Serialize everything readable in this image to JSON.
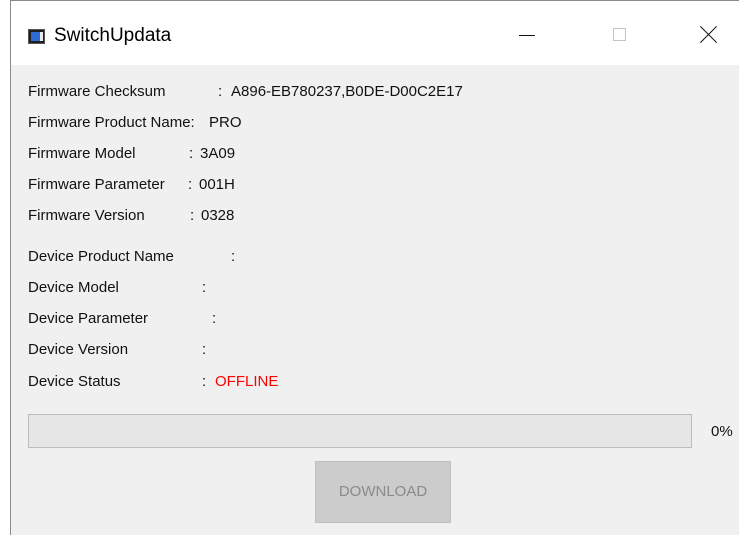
{
  "window": {
    "title": "SwitchUpdata",
    "icon": "app-window-icon",
    "controls": [
      "minimize-icon",
      "maximize-icon",
      "close-icon"
    ]
  },
  "firmware": [
    {
      "label": "Firmware Checksum",
      "sep": ":",
      "value": "A896-EB780237,B0DE-D00C2E17"
    },
    {
      "label": "Firmware Product Name:",
      "sep": "",
      "value": "PRO"
    },
    {
      "label": "Firmware Model",
      "sep": ":",
      "value": "3A09"
    },
    {
      "label": "Firmware Parameter",
      "sep": ":",
      "value": "001H"
    },
    {
      "label": "Firmware Version",
      "sep": ":",
      "value": "0328"
    }
  ],
  "device": [
    {
      "label": "Device Product Name",
      "sep": ":",
      "value": ""
    },
    {
      "label": "Device Model",
      "sep": ":",
      "value": ""
    },
    {
      "label": "Device Parameter",
      "sep": ":",
      "value": ""
    },
    {
      "label": "Device Version",
      "sep": ":",
      "value": ""
    },
    {
      "label": "Device Status",
      "sep": ":",
      "value": "OFFLINE"
    }
  ],
  "status_color": "#ff0000",
  "progress": {
    "value": 0,
    "label": "0%"
  },
  "download_button": {
    "label": "DOWNLOAD",
    "enabled": false
  }
}
